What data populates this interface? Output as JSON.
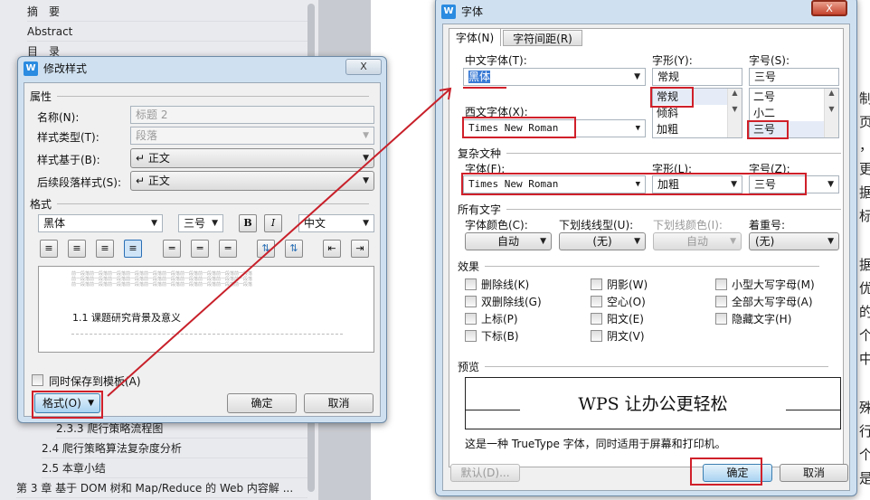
{
  "nav": {
    "items": [
      "摘　要",
      "Abstract",
      "目　录",
      "2.3.3 爬行策略流程图",
      "2.4 爬行策略算法复杂度分析",
      "2.5 本章小结",
      "第 3 章 基于 DOM 树和 Map/Reduce 的 Web 内容解 ..."
    ]
  },
  "doc_edge_chars": [
    "制",
    "页",
    "，",
    "更",
    "据",
    "标",
    "据",
    "优",
    "的",
    "个",
    "中",
    "殊",
    "行",
    "个",
    "是"
  ],
  "modify_style": {
    "title": "修改样式",
    "close": "X",
    "properties_label": "属性",
    "name_label": "名称(N):",
    "name_value": "标题 2",
    "type_label": "样式类型(T):",
    "type_value": "段落",
    "based_label": "样式基于(B):",
    "based_value": "↵ 正文",
    "next_label": "后续段落样式(S):",
    "next_value": "↵ 正文",
    "format_label": "格式",
    "font": "黑体",
    "size": "三号",
    "bold": "B",
    "italic": "I",
    "lang": "中文",
    "preview_prev": "前一段落前一段落前一段落前一段落前一段落前一段落前一段落前一段落前一段落前一段落",
    "preview_heading": "1.1  课题研究背景及意义",
    "save_template": "同时保存到模板(A)",
    "format_button": "格式(O)",
    "ok": "确定",
    "cancel": "取消"
  },
  "font_dialog": {
    "title": "字体",
    "close": "X",
    "tabs": [
      "字体(N)",
      "字符间距(R)"
    ],
    "cn_font_label": "中文字体(T):",
    "cn_font_value": "黑体",
    "style_label": "字形(Y):",
    "style_value": "常规",
    "style_options": [
      "常规",
      "倾斜",
      "加粗"
    ],
    "size_label": "字号(S):",
    "size_value": "三号",
    "size_options": [
      "二号",
      "小二",
      "三号"
    ],
    "west_font_label": "西文字体(X):",
    "west_font_value": "Times New Roman",
    "complex_label": "复杂文种",
    "c_font_label": "字体(F):",
    "c_font_value": "Times New Roman",
    "c_style_label": "字形(L):",
    "c_style_value": "加粗",
    "c_size_label": "字号(Z):",
    "c_size_value": "三号",
    "all_text_label": "所有文字",
    "color_label": "字体颜色(C):",
    "color_value": "自动",
    "underline_label": "下划线线型(U):",
    "underline_value": "(无)",
    "ucolor_label": "下划线颜色(I):",
    "ucolor_value": "自动",
    "emph_label": "着重号:",
    "emph_value": "(无)",
    "effects_label": "效果",
    "effects": [
      "删除线(K)",
      "双删除线(G)",
      "上标(P)",
      "下标(B)",
      "阴影(W)",
      "空心(O)",
      "阳文(E)",
      "阴文(V)",
      "小型大写字母(M)",
      "全部大写字母(A)",
      "隐藏文字(H)"
    ],
    "preview_label": "预览",
    "preview_text": "WPS 让办公更轻松",
    "note": "这是一种 TrueType 字体，同时适用于屏幕和打印机。",
    "default": "默认(D)...",
    "ok": "确定",
    "cancel": "取消"
  },
  "colors": {
    "annotation": "#d0202a",
    "accent": "#2a8be0"
  }
}
